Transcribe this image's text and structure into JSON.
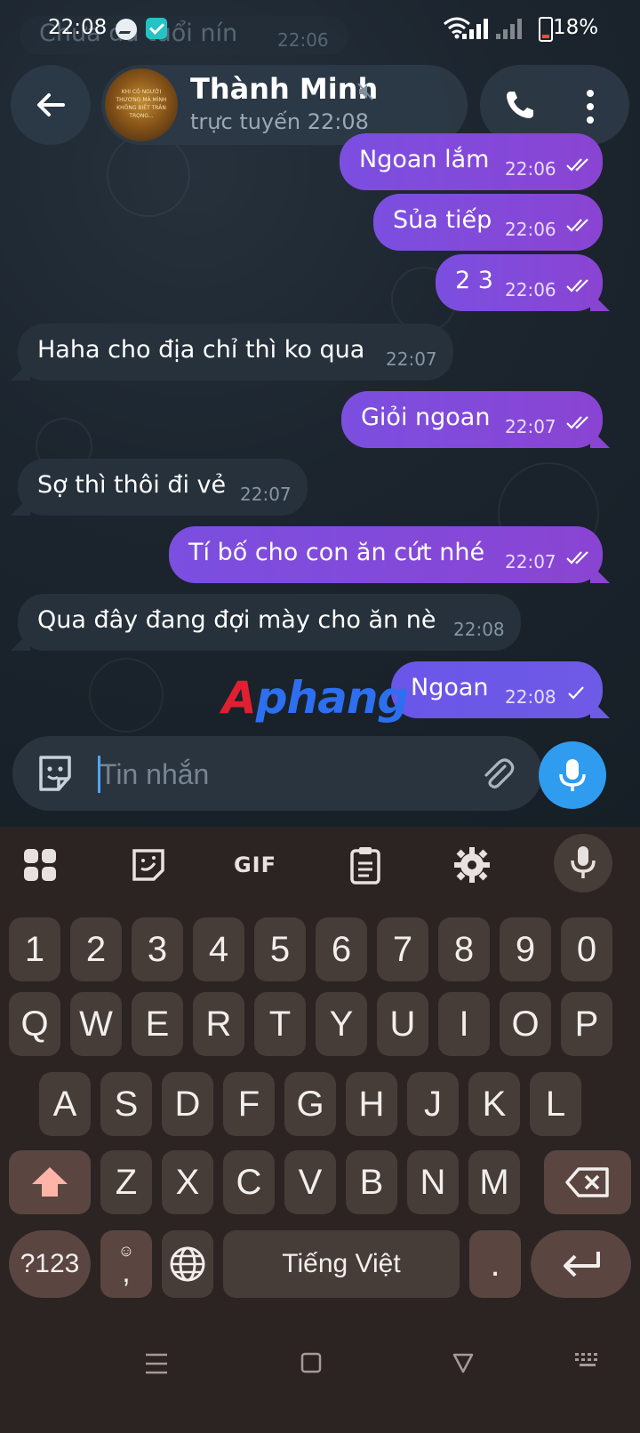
{
  "status_bar": {
    "time": "22:08",
    "battery": "18%",
    "icons": [
      "messenger-icon",
      "check-app-icon",
      "wifi-icon",
      "signal-icon",
      "battery-icon"
    ]
  },
  "ghost": {
    "text": "Chưa đủ tuổi nín",
    "time": "22:06"
  },
  "header": {
    "name": "Thành Minh",
    "status": "trực tuyến 22:08",
    "avatar_text": "KHI CÓ NGƯỜI THƯƠNG MÀ MÌNH KHÔNG BIẾT TRÂN TRỌNG..."
  },
  "messages": [
    {
      "dir": "out",
      "text": "Ngoan lắm",
      "time": "22:06",
      "read": true
    },
    {
      "dir": "out",
      "text": "Sủa tiếp",
      "time": "22:06",
      "read": true
    },
    {
      "dir": "out",
      "text": "2 3",
      "time": "22:06",
      "read": true
    },
    {
      "dir": "in",
      "text": "Haha cho địa chỉ thì ko qua",
      "time": "22:07"
    },
    {
      "dir": "out",
      "text": "Giỏi ngoan",
      "time": "22:07",
      "read": true
    },
    {
      "dir": "in",
      "text": "Sợ thì thôi đi vẻ",
      "time": "22:07"
    },
    {
      "dir": "out",
      "text": "Tí bố cho con ăn cứt nhé",
      "time": "22:07",
      "read": true
    },
    {
      "dir": "in",
      "text": "Qua đây đang đợi mày cho ăn nè",
      "time": "22:08"
    },
    {
      "dir": "out",
      "text": "Ngoan",
      "time": "22:08",
      "read": false
    }
  ],
  "watermark": {
    "part1": "A",
    "part2": "phang"
  },
  "composer": {
    "placeholder": "Tin nhắn"
  },
  "keyboard": {
    "toolbar": {
      "gif": "GIF"
    },
    "row_numbers": [
      "1",
      "2",
      "3",
      "4",
      "5",
      "6",
      "7",
      "8",
      "9",
      "0"
    ],
    "row1": [
      "Q",
      "W",
      "E",
      "R",
      "T",
      "Y",
      "U",
      "I",
      "O",
      "P"
    ],
    "row2": [
      "A",
      "S",
      "D",
      "F",
      "G",
      "H",
      "J",
      "K",
      "L"
    ],
    "row3": [
      "Z",
      "X",
      "C",
      "V",
      "B",
      "N",
      "M"
    ],
    "sym_key": "?123",
    "comma": ",",
    "space": "Tiếng Việt",
    "period": "."
  },
  "colors": {
    "outgoing": "#7b4fe0",
    "incoming": "#26313b",
    "accent": "#2f9cf0",
    "keyboard": "#2b2422"
  }
}
